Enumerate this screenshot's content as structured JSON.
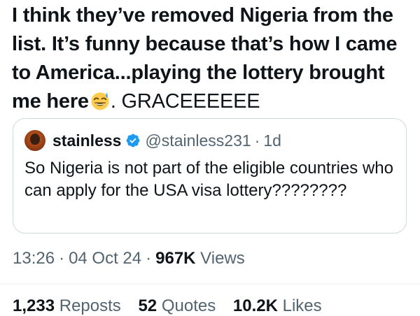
{
  "tweet": {
    "text_bold": "I think they’ve removed Nigeria from the list. It’s funny because that’s how I came to America...playing the lottery brought me here",
    "emoji_icon": "grinning-sweat-emoji",
    "text_normal": ". GRACEEEEEE"
  },
  "quote": {
    "name": "stainless",
    "handle": "@stainless231",
    "separator": "·",
    "time": "1d",
    "text": "So Nigeria is not part of the eligible countries who can apply for the USA visa lottery????????"
  },
  "meta": {
    "time": "13:26",
    "separator": "·",
    "date": "04 Oct 24",
    "views_count": "967K",
    "views_label": "Views"
  },
  "stats": {
    "reposts_count": "1,233",
    "reposts_label": "Reposts",
    "quotes_count": "52",
    "quotes_label": "Quotes",
    "likes_count": "10.2K",
    "likes_label": "Likes"
  },
  "colors": {
    "text": "#0f1419",
    "secondary": "#536471",
    "verified": "#1d9bf0",
    "border": "#cfd9de"
  }
}
